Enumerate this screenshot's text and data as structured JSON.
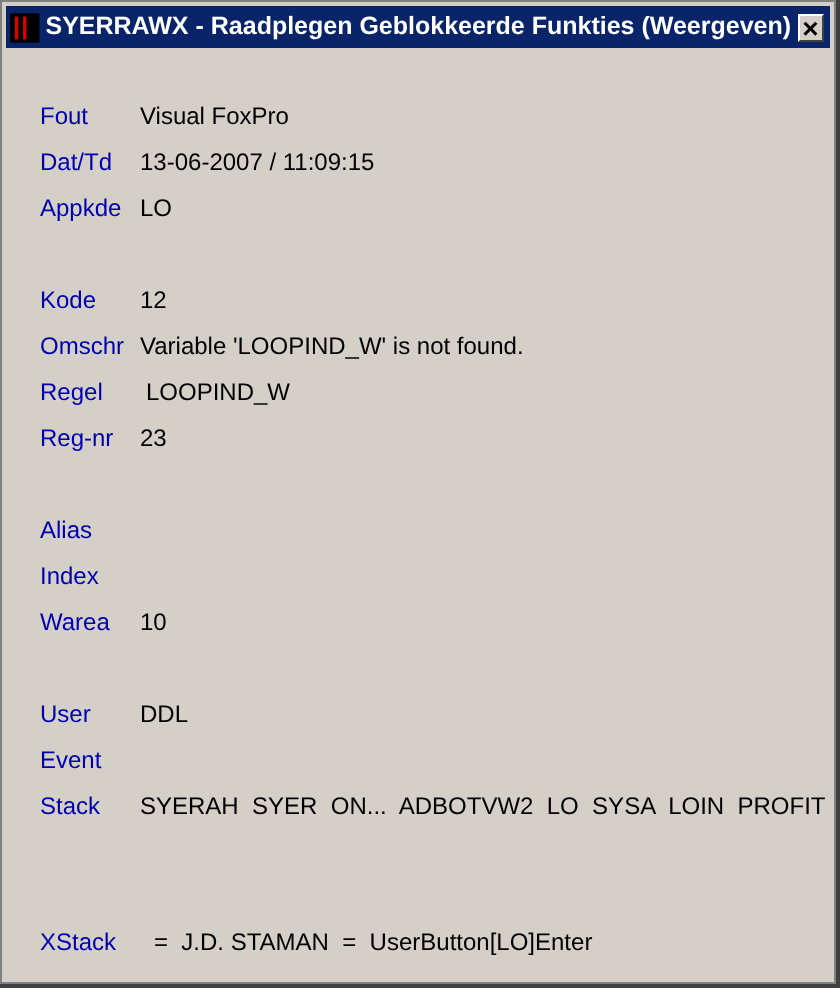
{
  "window": {
    "title": "SYERRAWX - Raadplegen Geblokkeerde Funkties (Weergeven)",
    "close": "×"
  },
  "groups": [
    {
      "rows": [
        {
          "label": "Fout",
          "value": "Visual FoxPro"
        },
        {
          "label": "Dat/Td",
          "value": "13-06-2007 / 11:09:15"
        },
        {
          "label": "Appkde",
          "value": "LO"
        }
      ]
    },
    {
      "rows": [
        {
          "label": "Kode",
          "value": "12"
        },
        {
          "label": "Omschr",
          "value": "Variable 'LOOPIND_W' is not found."
        },
        {
          "label": "Regel",
          "value": "LOOPIND_W"
        },
        {
          "label": "Reg-nr",
          "value": "23"
        }
      ]
    },
    {
      "rows": [
        {
          "label": "Alias"
        },
        {
          "label": "Index"
        },
        {
          "label": "Warea",
          "value": "10"
        }
      ]
    },
    {
      "rows": [
        {
          "label": "User",
          "value": "DDL"
        },
        {
          "label": "Event"
        },
        {
          "label": "Stack",
          "value": "SYERAH  SYER  ON...  ADBOTVW2  LO  SYSA  LOIN  PROFIT"
        }
      ]
    },
    {
      "rows": [
        {
          "label": "XStack",
          "value": "=  J.D. STAMAN  =  UserButton[LO]Enter"
        }
      ]
    }
  ]
}
